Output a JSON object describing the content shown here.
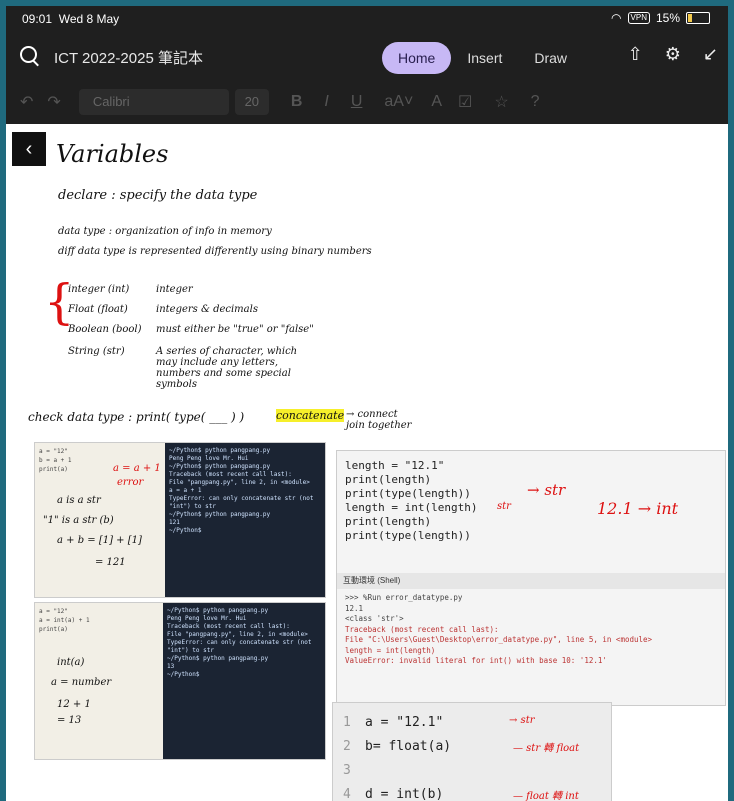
{
  "status": {
    "time": "09:01",
    "date": "Wed 8 May",
    "vpn": "VPN",
    "battery": "15%"
  },
  "header": {
    "notebook_title": "ICT 2022-2025 筆記本",
    "tabs": [
      "Home",
      "Insert",
      "Draw"
    ],
    "active_tab": "Home",
    "icons": [
      "share-icon",
      "gear-icon",
      "collapse-icon"
    ]
  },
  "toolbar": {
    "font": "Calibri",
    "size": "20"
  },
  "note": {
    "title": "Variables",
    "declare": "declare : specify the data type",
    "datatype1": "data type : organization of info in memory",
    "datatype2": "diff data type is represented differently using binary numbers",
    "types": [
      {
        "name": "integer (int)",
        "desc": "integer"
      },
      {
        "name": "Float (float)",
        "desc": "integers & decimals"
      },
      {
        "name": "Boolean (bool)",
        "desc": "must either be \"true\" or \"false\""
      },
      {
        "name": "String (str)",
        "desc": "A series of character, which may include any letters, numbers and some special symbols"
      }
    ],
    "check": "check data type : print( type( ___ ) )",
    "concatenate": "concatenate",
    "concatenate_note": "→ connect join together"
  },
  "shot1": {
    "code": [
      "a = \"12\"",
      "b = a + 1",
      "print(a)"
    ],
    "notes": [
      "a = a + 1",
      "error",
      "a is a str",
      "\"1\" is a str (b)",
      "a + b = [1] + [1]",
      "= 121"
    ],
    "term": [
      "~/Python$ python pangpang.py",
      "Peng Peng love Mr. Hui",
      "~/Python$ python pangpang.py",
      "Traceback (most recent call last):",
      "File \"pangpang.py\", line 2, in <module>",
      "a = a + 1",
      "TypeError: can only concatenate str (not \"int\") to str",
      "~/Python$ python pangpang.py",
      "121",
      "~/Python$"
    ]
  },
  "shot2": {
    "code": [
      "a = \"12\"",
      "a = int(a) + 1",
      "print(a)"
    ],
    "notes": [
      "int(a)",
      "a = number",
      "12 + 1",
      "= 13"
    ],
    "term": [
      "~/Python$ python pangpang.py",
      "Peng Peng love Mr. Hui",
      "Traceback (most recent call last):",
      "File \"pangpang.py\", line 2, in <module>",
      "TypeError: can only concatenate str (not \"int\") to str",
      "~/Python$ python pangpang.py",
      "13",
      "~/Python$"
    ]
  },
  "shot3": {
    "code": [
      "length = \"12.1\"",
      "print(length)",
      "print(type(length))",
      "",
      "length = int(length)",
      "print(length)",
      "print(type(length))"
    ],
    "annot": [
      "→ str",
      "12.1 → int",
      "str"
    ],
    "shell_tab": "互動環境 (Shell)",
    "shell": [
      ">>> %Run error_datatype.py",
      "12.1",
      "<class 'str'>",
      "Traceback (most recent call last):",
      "File \"C:\\Users\\Guest\\Desktop\\error_datatype.py\", line 5, in <module>",
      "length = int(length)",
      "ValueError: invalid literal for int() with base 10: '12.1'"
    ]
  },
  "shot4": {
    "code": [
      "a = \"12.1\"",
      "b= float(a)",
      "",
      "d = int(b)"
    ],
    "annot": [
      "→ str",
      "— str 轉 float",
      "— float 轉 int"
    ]
  }
}
